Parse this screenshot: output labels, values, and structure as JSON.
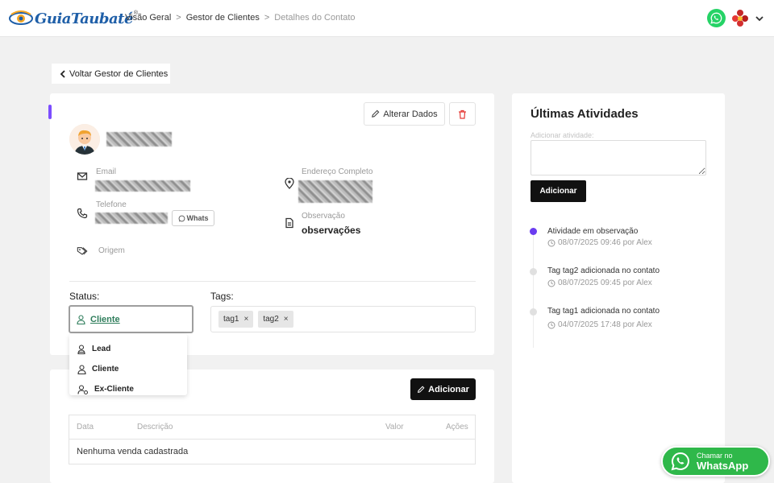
{
  "header": {
    "logo_text": "GuiaTaubaté",
    "logo_reg": "®",
    "breadcrumb": [
      "Visão Geral",
      "Gestor de Clientes",
      "Detalhes do Contato"
    ],
    "separator": ">"
  },
  "back_button": {
    "label": "Voltar Gestor de Clientes"
  },
  "contact": {
    "edit_label": "Alterar Dados",
    "fields": {
      "email_label": "Email",
      "phone_label": "Telefone",
      "whats_label": "Whats",
      "address_label": "Endereço Completo",
      "observation_label": "Observação",
      "observation_value": "observações",
      "origin_label": "Origem"
    },
    "status_label": "Status:",
    "status_value": "Cliente",
    "tags_label": "Tags:",
    "tags": [
      "tag1",
      "tag2"
    ],
    "tag_remove": "×"
  },
  "status_dropdown": {
    "options": [
      "Lead",
      "Cliente",
      "Ex-Cliente"
    ]
  },
  "sales": {
    "add_label": "Adicionar",
    "columns": [
      "Data",
      "Descrição",
      "Valor",
      "Ações"
    ],
    "empty_text": "Nenhuma venda cadastrada"
  },
  "activities": {
    "title": "Últimas Atividades",
    "input_label": "Adicionar atividade:",
    "submit_label": "Adicionar",
    "items": [
      {
        "title": "Atividade em observação",
        "meta": "08/07/2025 09:46 por Alex"
      },
      {
        "title": "Tag tag2 adicionada no contato",
        "meta": "08/07/2025 09:45 por Alex"
      },
      {
        "title": "Tag tag1 adicionada no contato",
        "meta": "04/07/2025 17:48 por Alex"
      }
    ]
  },
  "whatsapp_float": {
    "line1": "Chamar no",
    "line2": "WhatsApp"
  },
  "colors": {
    "accent_purple": "#6a3cf0",
    "whatsapp_green": "#25d366",
    "status_green": "#2e7d5b",
    "brand_blue": "#1f5fa8"
  }
}
